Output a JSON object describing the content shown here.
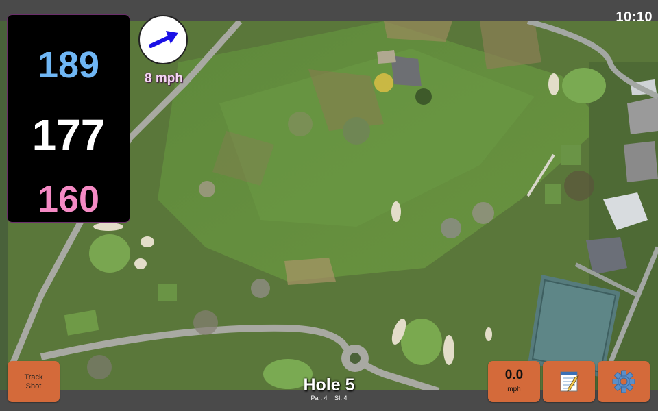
{
  "status_bar": {
    "time": "10:10"
  },
  "distances": {
    "back": "189",
    "middle": "177",
    "front": "160",
    "colors": {
      "back": "#6fb6f4",
      "middle": "#ffffff",
      "front": "#f48ac4"
    }
  },
  "wind": {
    "speed_label": "8 mph",
    "direction_icon": "wind-arrow-icon",
    "arrow_color": "#1a10e6"
  },
  "map": {
    "type": "satellite-golf-hole"
  },
  "buttons": {
    "track_shot": "Track Shot",
    "speed_value": "0.0",
    "speed_unit": "mph",
    "notes_icon": "notepad-icon",
    "settings_icon": "gear-icon",
    "accent": "#d46a3a"
  },
  "hole": {
    "title": "Hole 5",
    "par": "Par: 4",
    "si": "SI: 4"
  }
}
